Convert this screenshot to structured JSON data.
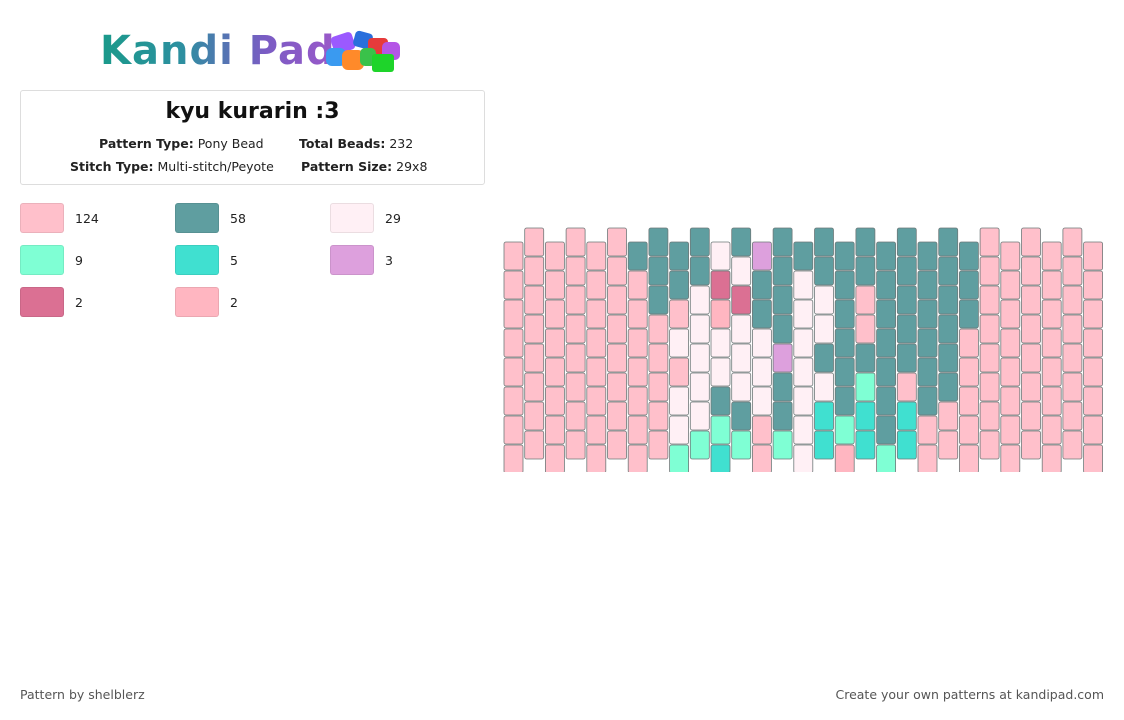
{
  "header": {
    "logo_text": "Kandi Pad",
    "logo_icon": "bead-pile-icon"
  },
  "pattern": {
    "title": "kyu kurarin :3",
    "type_label": "Pattern Type:",
    "type_value": "Pony Bead",
    "beads_label": "Total Beads:",
    "beads_value": "232",
    "stitch_label": "Stitch Type:",
    "stitch_value": "Multi-stitch/Peyote",
    "size_label": "Pattern Size:",
    "size_value": "29x8"
  },
  "colors": {
    "pink": "#FFC0CB",
    "teal": "#5F9EA0",
    "white": "#FFF0F5",
    "mint": "#7FFFD4",
    "turquoise": "#40E0D0",
    "orchid": "#DDA0DD",
    "rose": "#DB7093",
    "lightpink": "#FFB6C1"
  },
  "legend": [
    {
      "color": "#FFC0CB",
      "count": "124"
    },
    {
      "color": "#5F9EA0",
      "count": "58"
    },
    {
      "color": "#FFF0F5",
      "count": "29"
    },
    {
      "color": "#7FFFD4",
      "count": "9"
    },
    {
      "color": "#40E0D0",
      "count": "5"
    },
    {
      "color": "#DDA0DD",
      "count": "3"
    },
    {
      "color": "#DB7093",
      "count": "2"
    },
    {
      "color": "#FFB6C1",
      "count": "2"
    }
  ],
  "footer": {
    "credit": "Pattern by shelblerz",
    "promo": "Create your own patterns at kandipad.com"
  }
}
